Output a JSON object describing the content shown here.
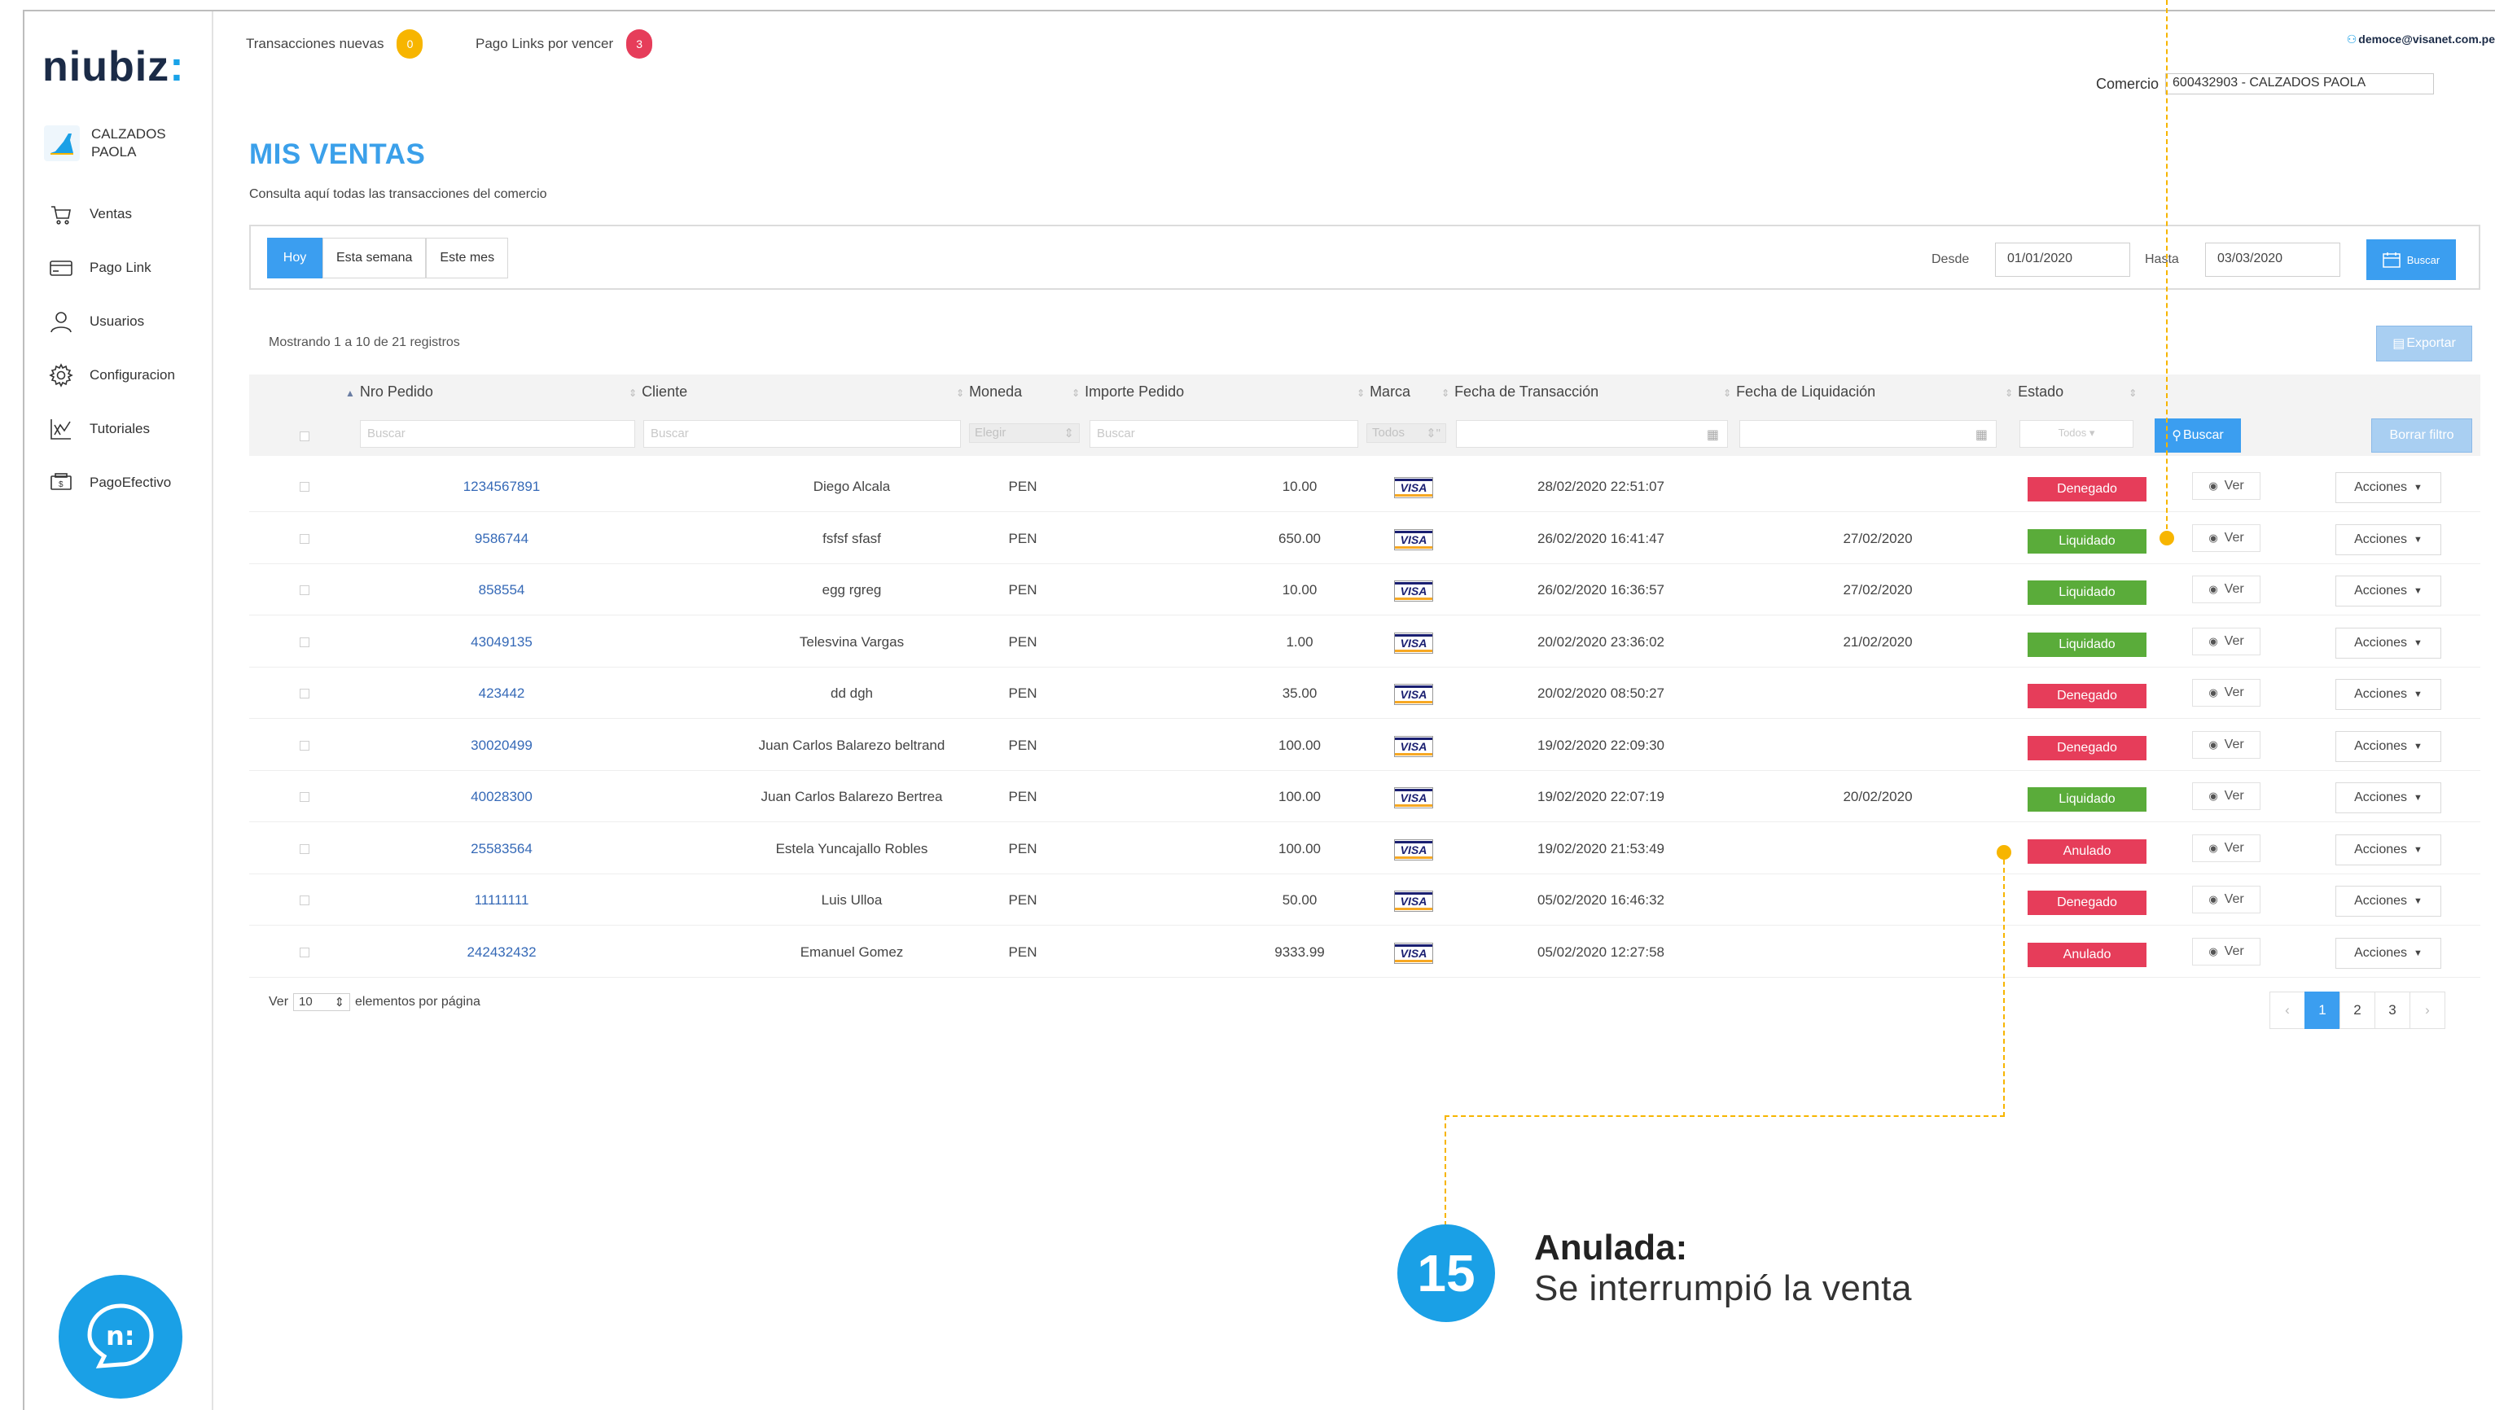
{
  "brand": {
    "logo_text": "niubiz",
    "logo_colon": ":"
  },
  "sidebar": {
    "merchant_name": "CALZADOS PAOLA",
    "items": [
      {
        "label": "Ventas",
        "icon": "cart-icon"
      },
      {
        "label": "Pago Link",
        "icon": "card-icon"
      },
      {
        "label": "Usuarios",
        "icon": "user-icon"
      },
      {
        "label": "Configuracion",
        "icon": "gear-icon"
      },
      {
        "label": "Tutoriales",
        "icon": "tutorial-icon"
      },
      {
        "label": "PagoEfectivo",
        "icon": "cash-icon"
      }
    ],
    "chat_label": "n:"
  },
  "header": {
    "notif_transactions_label": "Transacciones nuevas",
    "notif_transactions_count": "0",
    "notif_links_label": "Pago Links por vencer",
    "notif_links_count": "3",
    "user_email": "democe@visanet.com.pe",
    "comercio_label": "Comercio",
    "comercio_value": "600432903 - CALZADOS PAOLA"
  },
  "page": {
    "title": "MIS VENTAS",
    "subtitle": "Consulta aquí todas las transacciones del comercio"
  },
  "filters": {
    "tabs": [
      "Hoy",
      "Esta semana",
      "Este mes"
    ],
    "active_tab": "Hoy",
    "desde_label": "Desde",
    "desde_value": "01/01/2020",
    "hasta_label": "Hasta",
    "hasta_value": "03/03/2020",
    "buscar_label": "Buscar"
  },
  "table": {
    "records_text": "Mostrando 1 a 10 de 21 registros",
    "export_label": "Exportar",
    "columns": [
      "Nro Pedido",
      "Cliente",
      "Moneda",
      "Importe Pedido",
      "Marca",
      "Fecha de Transacción",
      "Fecha de Liquidación",
      "Estado"
    ],
    "filter_placeholders": {
      "nro": "Buscar",
      "cliente": "Buscar",
      "moneda": "Elegir",
      "importe": "Buscar",
      "marca": "Todos",
      "estado": "Todos"
    },
    "buscar_label": "Buscar",
    "borrar_label": "Borrar filtro",
    "ver_label": "Ver",
    "acciones_label": "Acciones",
    "rows": [
      {
        "nro": "1234567891",
        "cliente": "Diego Alcala",
        "moneda": "PEN",
        "importe": "10.00",
        "marca": "VISA",
        "fecha_tx": "28/02/2020 22:51:07",
        "fecha_liq": "",
        "estado": "Denegado"
      },
      {
        "nro": "9586744",
        "cliente": "fsfsf sfasf",
        "moneda": "PEN",
        "importe": "650.00",
        "marca": "VISA",
        "fecha_tx": "26/02/2020 16:41:47",
        "fecha_liq": "27/02/2020",
        "estado": "Liquidado"
      },
      {
        "nro": "858554",
        "cliente": "egg rgreg",
        "moneda": "PEN",
        "importe": "10.00",
        "marca": "VISA",
        "fecha_tx": "26/02/2020 16:36:57",
        "fecha_liq": "27/02/2020",
        "estado": "Liquidado"
      },
      {
        "nro": "43049135",
        "cliente": "Telesvina Vargas",
        "moneda": "PEN",
        "importe": "1.00",
        "marca": "VISA",
        "fecha_tx": "20/02/2020 23:36:02",
        "fecha_liq": "21/02/2020",
        "estado": "Liquidado"
      },
      {
        "nro": "423442",
        "cliente": "dd dgh",
        "moneda": "PEN",
        "importe": "35.00",
        "marca": "VISA",
        "fecha_tx": "20/02/2020 08:50:27",
        "fecha_liq": "",
        "estado": "Denegado"
      },
      {
        "nro": "30020499",
        "cliente": "Juan Carlos Balarezo beltrand",
        "moneda": "PEN",
        "importe": "100.00",
        "marca": "VISA",
        "fecha_tx": "19/02/2020 22:09:30",
        "fecha_liq": "",
        "estado": "Denegado"
      },
      {
        "nro": "40028300",
        "cliente": "Juan Carlos Balarezo Bertrea",
        "moneda": "PEN",
        "importe": "100.00",
        "marca": "VISA",
        "fecha_tx": "19/02/2020 22:07:19",
        "fecha_liq": "20/02/2020",
        "estado": "Liquidado"
      },
      {
        "nro": "25583564",
        "cliente": "Estela Yuncajallo Robles",
        "moneda": "PEN",
        "importe": "100.00",
        "marca": "VISA",
        "fecha_tx": "19/02/2020 21:53:49",
        "fecha_liq": "",
        "estado": "Anulado"
      },
      {
        "nro": "11111111",
        "cliente": "Luis Ulloa",
        "moneda": "PEN",
        "importe": "50.00",
        "marca": "VISA",
        "fecha_tx": "05/02/2020 16:46:32",
        "fecha_liq": "",
        "estado": "Denegado"
      },
      {
        "nro": "242432432",
        "cliente": "Emanuel Gomez",
        "moneda": "PEN",
        "importe": "9333.99",
        "marca": "VISA",
        "fecha_tx": "05/02/2020 12:27:58",
        "fecha_liq": "",
        "estado": "Anulado"
      }
    ],
    "page_size_prefix": "Ver",
    "page_size_value": "10",
    "page_size_suffix": "elementos por página",
    "pages": [
      "1",
      "2",
      "3"
    ],
    "prev_label": "‹",
    "next_label": "›"
  },
  "annotation": {
    "step_number": "15",
    "title": "Anulada:",
    "description": "Se interrumpió la venta"
  },
  "colors": {
    "accent": "#3b9ef0",
    "brand_blue": "#1aa0e6",
    "denegado": "#e63d5a",
    "liquidado": "#5aac3a",
    "anulado": "#e63d5a",
    "badge_yellow": "#f7b500",
    "badge_red": "#e63d5a",
    "annotation": "#f7b500"
  }
}
